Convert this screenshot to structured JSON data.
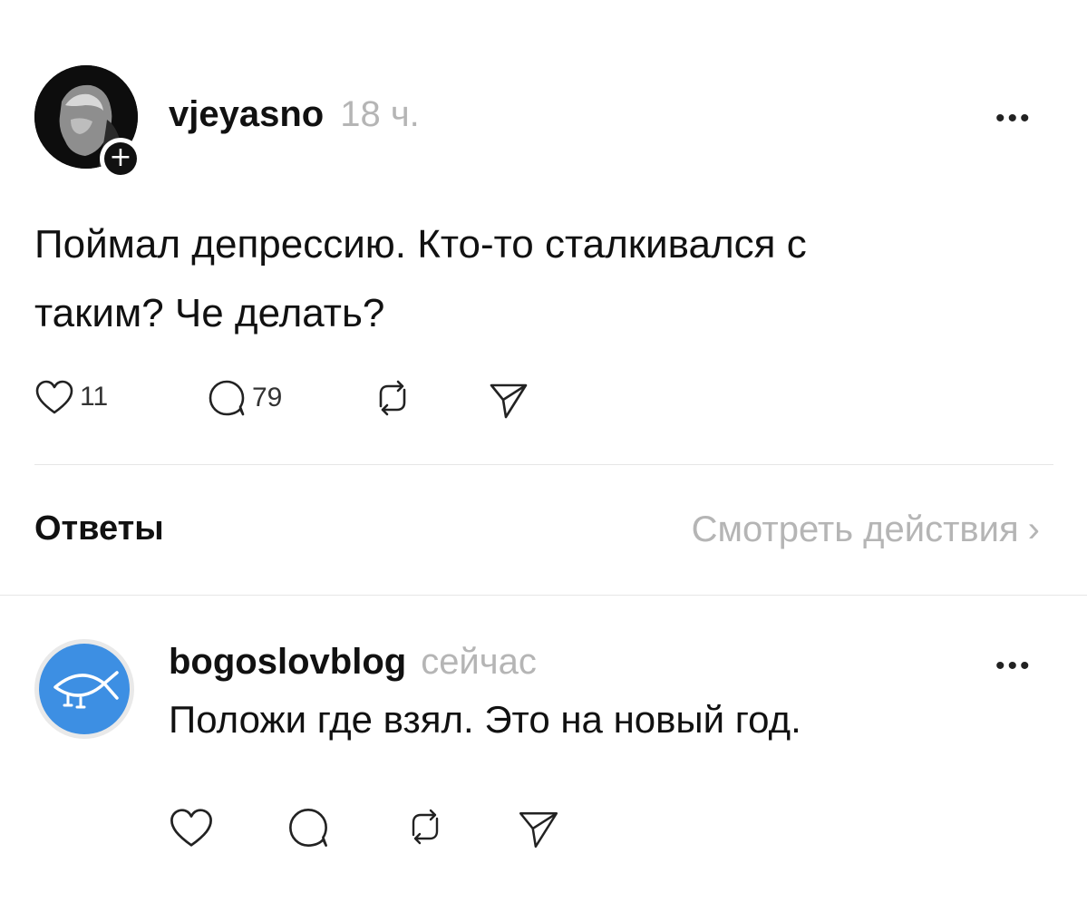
{
  "post": {
    "username": "vjeyasno",
    "time": "18 ч.",
    "more": "•••",
    "text_line1": "Поймал депрессию. Кто-то сталкивался с",
    "text_line2": "таким? Че делать?",
    "likes": "11",
    "comments": "79",
    "icons": [
      "heart-icon",
      "comment-icon",
      "repost-icon",
      "share-icon"
    ],
    "follow_badge": "+"
  },
  "replies_header": {
    "title": "Ответы",
    "see_activity": "Смотреть действия",
    "chevron": "›"
  },
  "reply": {
    "username": "bogoslovblog",
    "time": "сейчас",
    "more": "•••",
    "text": "Положи где взял. Это на новый год.",
    "icons": [
      "heart-icon",
      "comment-icon",
      "repost-icon",
      "share-icon"
    ]
  },
  "colors": {
    "text": "#111111",
    "muted": "#b5b5b5",
    "divider": "#e6e6e6",
    "avatar_blue": "#3d8fe3"
  }
}
